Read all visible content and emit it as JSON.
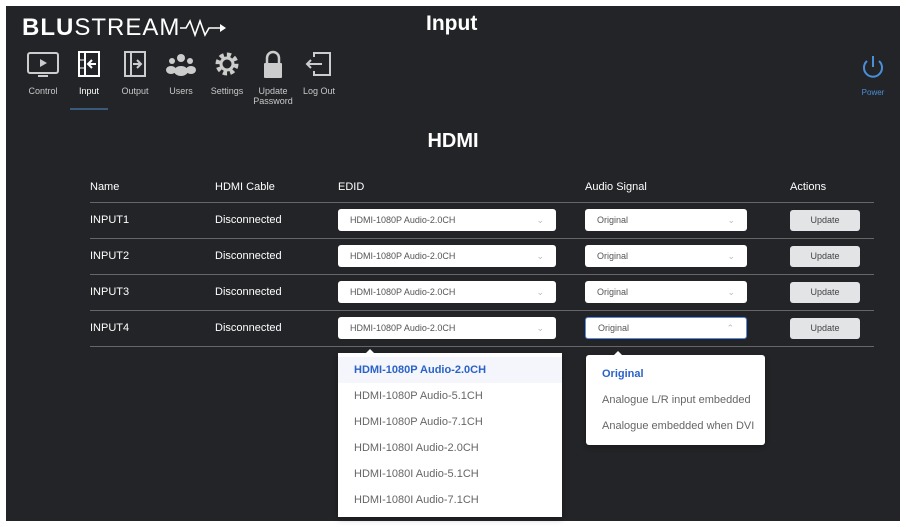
{
  "header": {
    "logo": "BLUSTREAM",
    "title": "Input"
  },
  "nav": [
    {
      "label": "Control",
      "icon": "monitor-play-icon"
    },
    {
      "label": "Input",
      "icon": "input-arrow-icon",
      "active": true
    },
    {
      "label": "Output",
      "icon": "output-arrow-icon"
    },
    {
      "label": "Users",
      "icon": "users-icon"
    },
    {
      "label": "Settings",
      "icon": "gear-icon"
    },
    {
      "label": "Update Password",
      "icon": "lock-icon"
    },
    {
      "label": "Log Out",
      "icon": "logout-icon"
    }
  ],
  "power": {
    "label": "Power",
    "color": "#4a8fd8"
  },
  "section_title": "HDMI",
  "table": {
    "headers": [
      "Name",
      "HDMI Cable",
      "EDID",
      "Audio Signal",
      "Actions"
    ],
    "rows": [
      {
        "name": "INPUT1",
        "cable": "Disconnected",
        "edid": "HDMI-1080P Audio-2.0CH",
        "audio": "Original",
        "action": "Update"
      },
      {
        "name": "INPUT2",
        "cable": "Disconnected",
        "edid": "HDMI-1080P Audio-2.0CH",
        "audio": "Original",
        "action": "Update"
      },
      {
        "name": "INPUT3",
        "cable": "Disconnected",
        "edid": "HDMI-1080P Audio-2.0CH",
        "audio": "Original",
        "action": "Update"
      },
      {
        "name": "INPUT4",
        "cable": "Disconnected",
        "edid": "HDMI-1080P Audio-2.0CH",
        "audio": "Original",
        "action": "Update"
      }
    ]
  },
  "edid_options": [
    "HDMI-1080P Audio-2.0CH",
    "HDMI-1080P Audio-5.1CH",
    "HDMI-1080P Audio-7.1CH",
    "HDMI-1080I Audio-2.0CH",
    "HDMI-1080I Audio-5.1CH",
    "HDMI-1080I Audio-7.1CH"
  ],
  "audio_options": [
    "Original",
    "Analogue L/R input embedded",
    "Analogue embedded when DVI"
  ]
}
